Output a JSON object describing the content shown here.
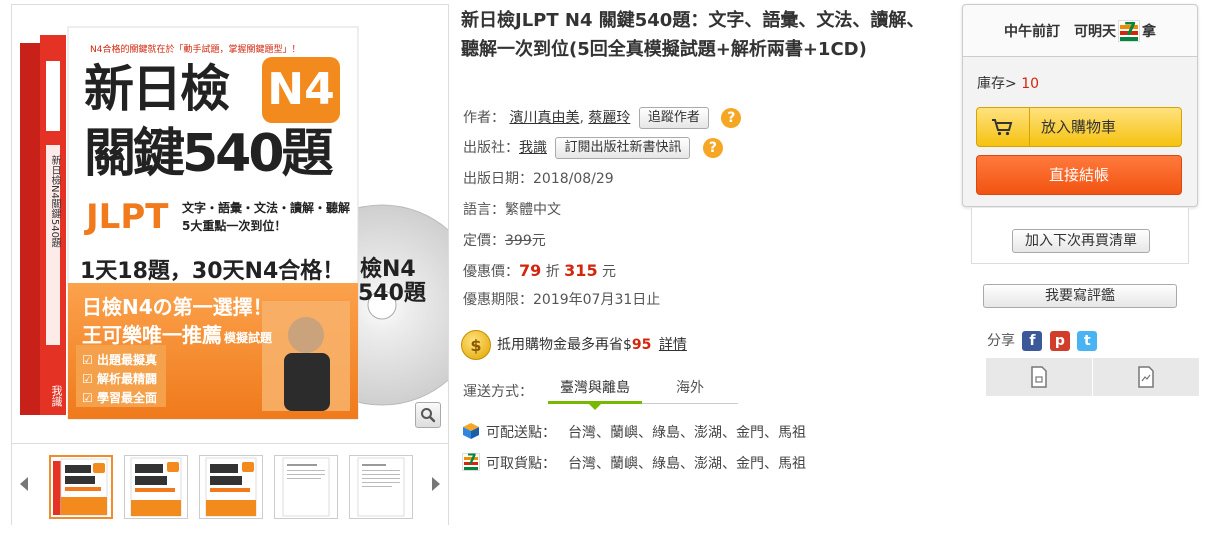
{
  "product": {
    "title": "新日檢JLPT N4 關鍵540題：文字、語彙、文法、讀解、聽解一次到位(5回全真模擬試題+解析兩書+1CD)",
    "author_label": "作者：",
    "authors": [
      "濱川真由美",
      "蔡麗玲"
    ],
    "author_sep": ",",
    "follow_author_button": "追蹤作者",
    "publisher_label": "出版社：",
    "publisher": "我識",
    "subscribe_button": "訂閱出版社新書快訊",
    "pub_date_label": "出版日期：",
    "pub_date": "2018/08/29",
    "language_label": "語言：",
    "language": "繁體中文",
    "list_price_label": "定價：",
    "list_price": "399",
    "currency_unit": "元",
    "sale_label": "優惠價：",
    "discount": "79",
    "discount_unit": "折",
    "sale_price": "315",
    "deadline_label": "優惠期限：",
    "deadline": "2019年07月31日止",
    "coin_text_prefix": "抵用購物金最多再省$",
    "coin_amount": "95",
    "coin_details_link": "詳情",
    "help_icon_glyph": "?",
    "coin_glyph": "$"
  },
  "shipping": {
    "label": "運送方式：",
    "tabs": [
      {
        "label": "臺灣與離島",
        "active": true
      },
      {
        "label": "海外",
        "active": false
      }
    ],
    "delivery_label": "可配送點：",
    "delivery_areas": "台灣、蘭嶼、綠島、澎湖、金門、馬祖",
    "pickup_label": "可取貨點：",
    "pickup_areas": "台灣、蘭嶼、綠島、澎湖、金門、馬祖"
  },
  "cover": {
    "top_slogan": "N4合格的關鍵就在於「動手試題，掌握關鍵題型」！",
    "title_line1": "新日檢",
    "badge": "N4",
    "title_line2": "關鍵540題",
    "jlpt": "JLPT",
    "skills_line1": "文字・語彙・文法・讀解・聽解",
    "skills_line2": "5大重點一次到位！",
    "tagline": "1天18題，30天N4合格！",
    "banner_line1": "日檢N4の第一選擇！",
    "banner_line2": "王可樂唯一推薦",
    "banner_suffix": "模擬試題",
    "checklist": [
      "出題最擬真",
      "解析最精闢",
      "學習最全面"
    ],
    "disc_title": "檢N4",
    "disc_sub": "540題",
    "spine_text": "新日檢N4關鍵540題",
    "publisher_mark": "我識"
  },
  "buy_box": {
    "head_text_1": "中午前訂",
    "head_text_2": "可明天",
    "head_text_3": "拿",
    "seven_glyph": "7",
    "stock_label": "庫存>",
    "stock_value": "10",
    "add_to_cart": "放入購物車",
    "checkout": "直接結帳",
    "wishlist": "加入下次再買清單",
    "review": "我要寫評鑑"
  },
  "share": {
    "label": "分享",
    "facebook_glyph": "f",
    "plurk_glyph": "p",
    "twitter_glyph": "t"
  },
  "colors": {
    "accent_orange": "#f26a1b",
    "price_red": "#d3260d",
    "cart_yellow": "#f5c20f",
    "ship_green": "#77b900"
  }
}
